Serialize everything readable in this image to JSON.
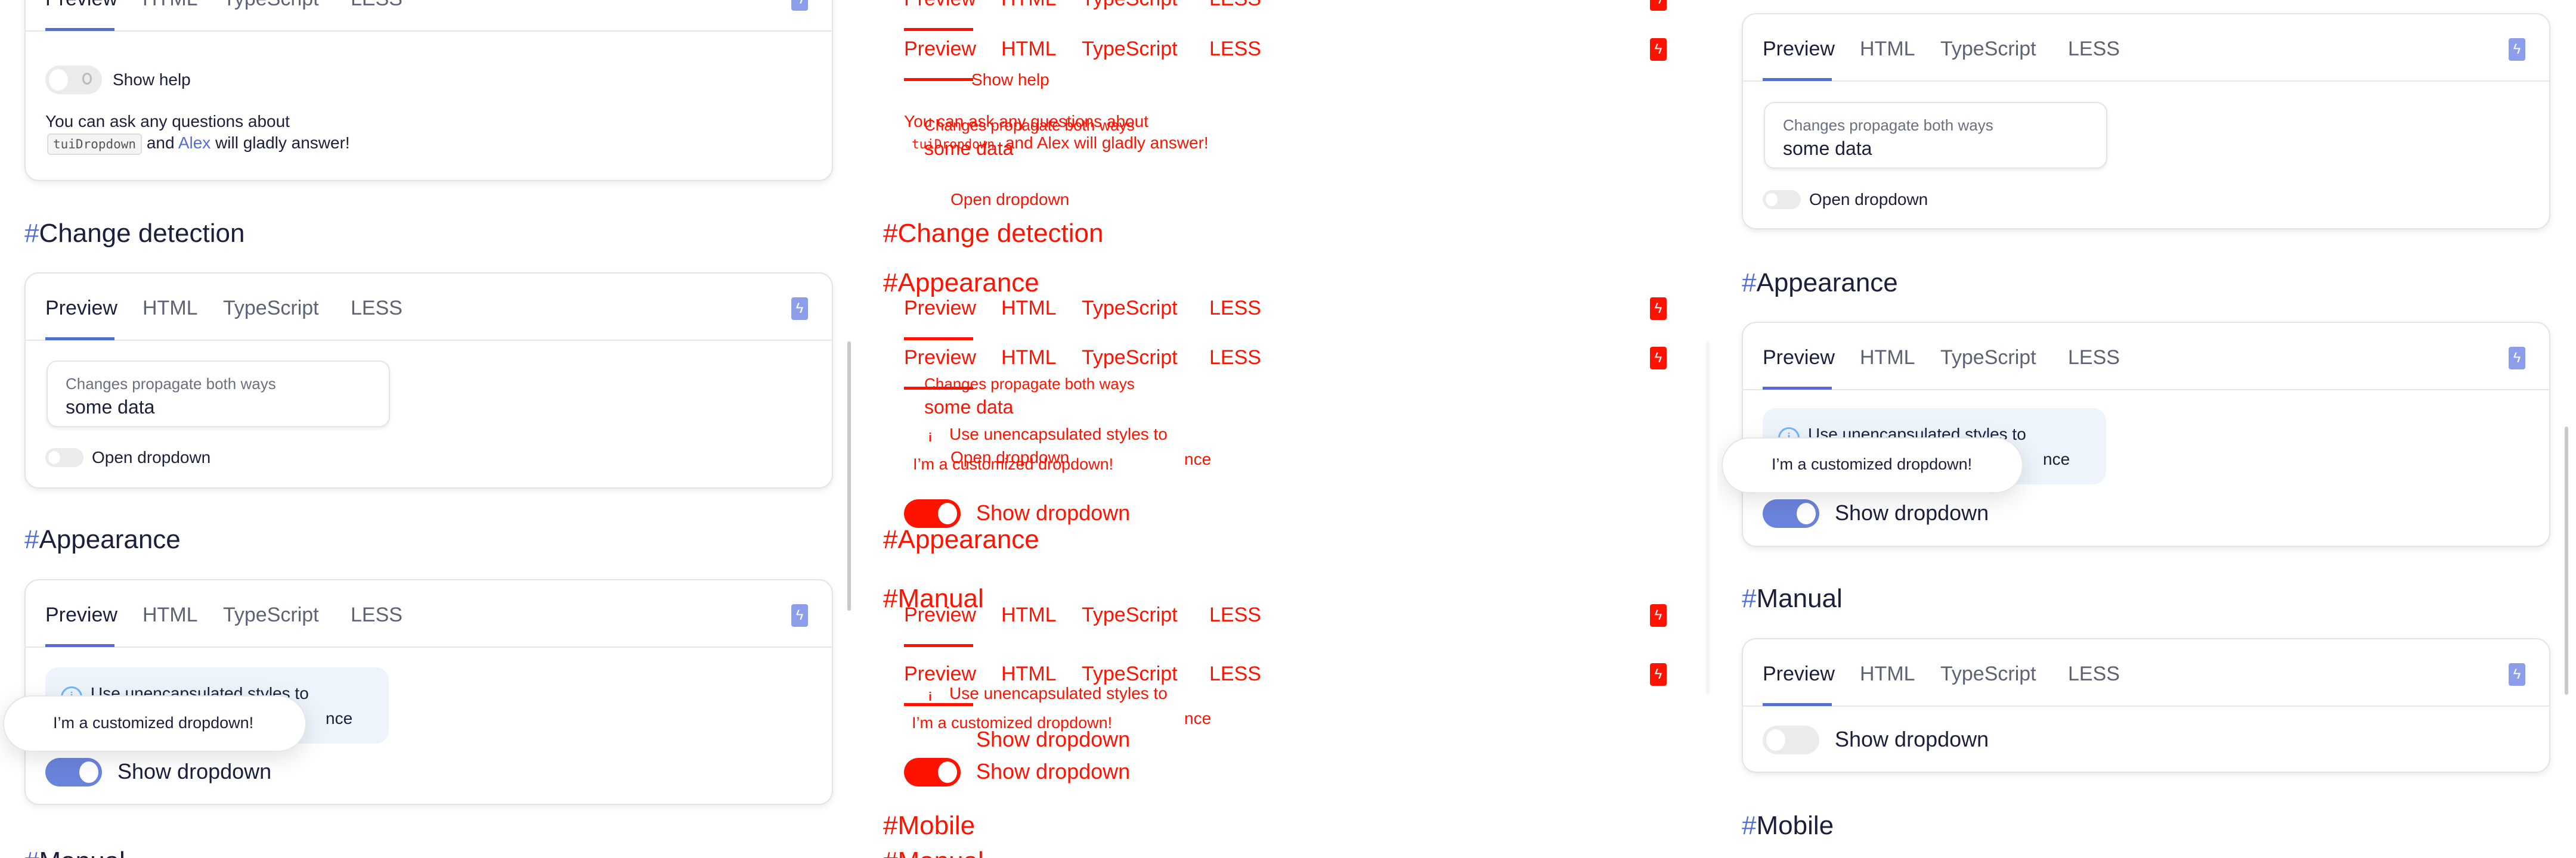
{
  "tabs": [
    "Preview",
    "HTML",
    "TypeScript",
    "LESS"
  ],
  "hash": "#",
  "sections": {
    "change_detection": "Change detection",
    "appearance": "Appearance",
    "manual": "Manual",
    "mobile": "Mobile"
  },
  "help": {
    "toggle_label": "Show help",
    "toggle_on": false,
    "text_before": "You can ask any questions about",
    "code": "tuiDropdown",
    "text_and": "and",
    "link": "Alex",
    "text_after": "will gladly answer!"
  },
  "change_detection": {
    "input_label": "Changes propagate both ways",
    "input_value": "some data",
    "toggle_label": "Open dropdown",
    "toggle_on": false
  },
  "appearance": {
    "notice_line1": "Use unencapsulated styles to",
    "notice_line2": "nce",
    "toggle_label": "Show dropdown",
    "toggle_on": true,
    "dropdown_text": "I’m a customized dropdown!"
  },
  "manual": {
    "toggle_label": "Show dropdown",
    "toggle_on": false
  },
  "colors": {
    "accent": "#526ed3",
    "toggle_on": "#6a84dc",
    "diff": "#ff1200",
    "notice_bg": "#edf4fc"
  }
}
